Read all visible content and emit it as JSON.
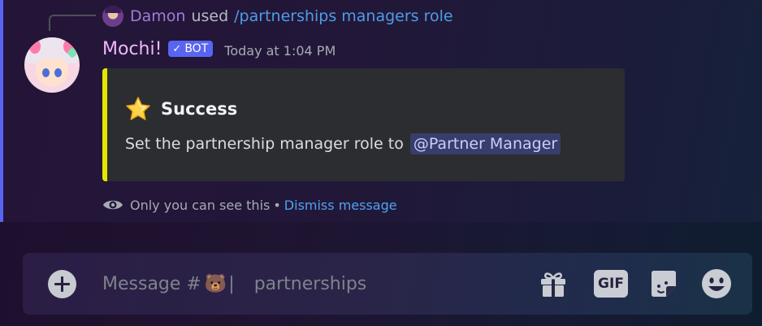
{
  "reply": {
    "username": "Damon",
    "used_text": "used",
    "command": "/partnerships managers role"
  },
  "message": {
    "author": "Mochi!",
    "bot_tag": "BOT",
    "bot_check": "✓",
    "timestamp": "Today at 1:04 PM"
  },
  "embed": {
    "accent_color": "#e5e500",
    "icon": "star-icon",
    "title": "Success",
    "description": "Set the partnership manager role to",
    "mention": "@Partner Manager"
  },
  "ephemeral": {
    "notice": "Only you can see this",
    "separator": "•",
    "dismiss_label": "Dismiss message"
  },
  "composer": {
    "placeholder_prefix": "Message #",
    "channel_emoji": "🐻",
    "channel_divider": "|",
    "channel_name": "partnerships",
    "gif_label": "GIF"
  },
  "colors": {
    "highlight_bar": "#5865f2",
    "bot_tag": "#5865f2",
    "link": "#4ea3ef",
    "username": "#f0b8ff"
  }
}
